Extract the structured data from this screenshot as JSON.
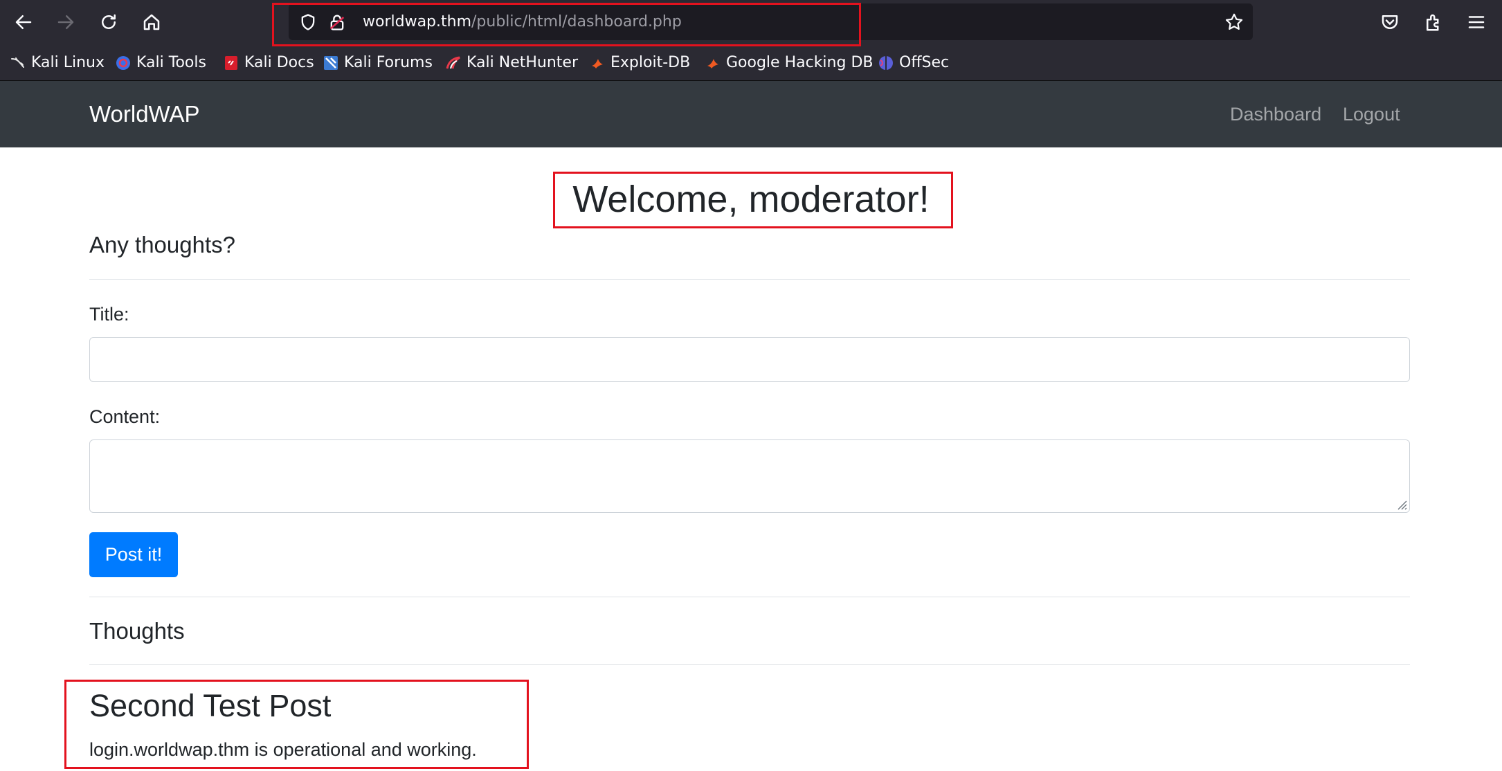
{
  "browser": {
    "url_host": "worldwap.thm",
    "url_path": "/public/html/dashboard.php",
    "bookmarks": [
      {
        "label": "Kali Linux",
        "icon": "kali-dragon-icon"
      },
      {
        "label": "Kali Tools",
        "icon": "kali-tools-icon"
      },
      {
        "label": "Kali Docs",
        "icon": "kali-docs-icon"
      },
      {
        "label": "Kali Forums",
        "icon": "kali-forums-icon"
      },
      {
        "label": "Kali NetHunter",
        "icon": "kali-nethunter-icon"
      },
      {
        "label": "Exploit-DB",
        "icon": "exploit-db-icon"
      },
      {
        "label": "Google Hacking DB",
        "icon": "ghdb-icon"
      },
      {
        "label": "OffSec",
        "icon": "offsec-icon"
      }
    ]
  },
  "navbar": {
    "brand": "WorldWAP",
    "links": [
      "Dashboard",
      "Logout"
    ]
  },
  "main": {
    "welcome": "Welcome, moderator!",
    "form_heading": "Any thoughts?",
    "title_label": "Title:",
    "title_value": "",
    "content_label": "Content:",
    "content_value": "",
    "submit_label": "Post it!",
    "thoughts_heading": "Thoughts",
    "posts": [
      {
        "title": "Second Test Post",
        "content": "login.worldwap.thm is operational and working."
      }
    ]
  },
  "colors": {
    "navbar_bg": "#343a40",
    "primary_button": "#007bff",
    "annotation_box": "#e3121e",
    "browser_chrome": "#2b2a33"
  }
}
